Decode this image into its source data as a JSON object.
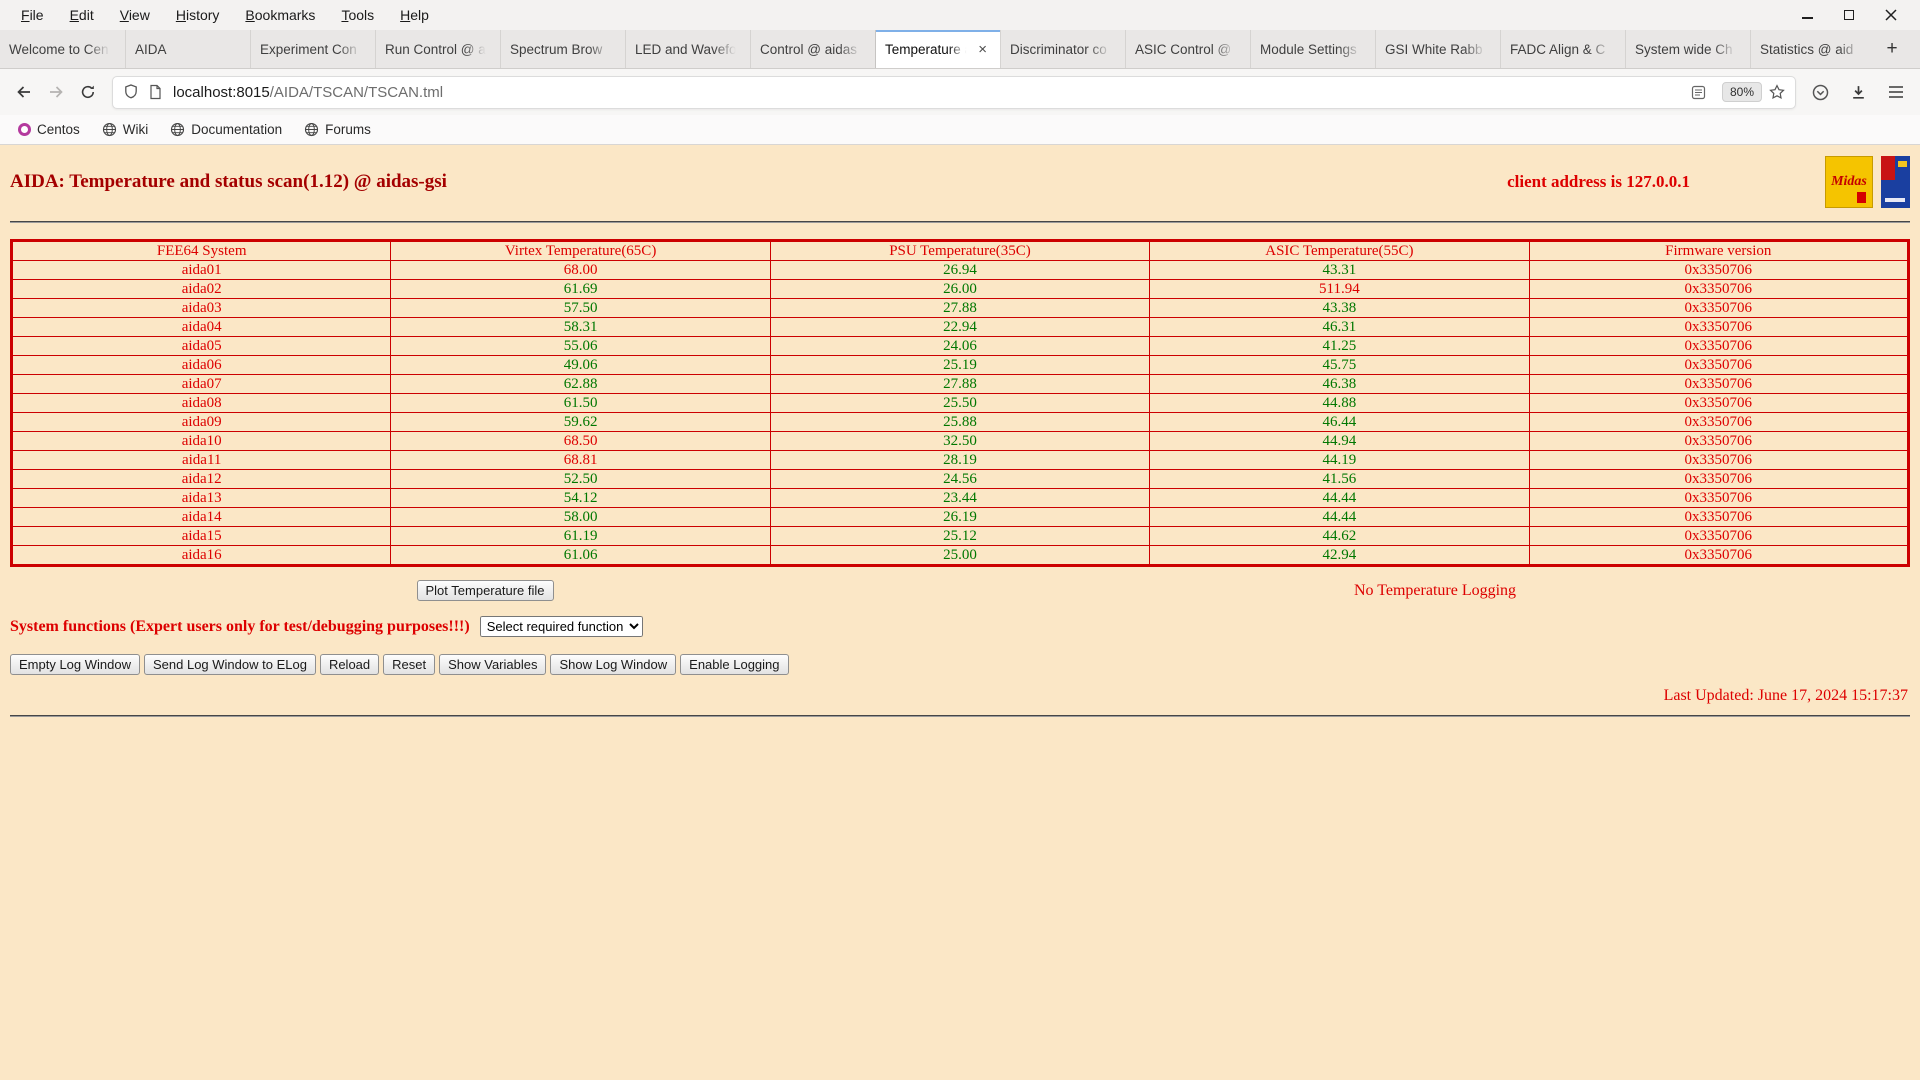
{
  "colors": {
    "page_bg": "#fbe7c6",
    "text_red": "#dd0000",
    "text_green": "#007700",
    "title_red": "#a40000",
    "table_border": "#cc0000"
  },
  "window": {
    "menu_items": [
      "File",
      "Edit",
      "View",
      "History",
      "Bookmarks",
      "Tools",
      "Help"
    ]
  },
  "tab_strip": {
    "close_glyph": "×",
    "new_tab_glyph": "+",
    "tabs": [
      {
        "label": "Welcome to Cen",
        "active": false
      },
      {
        "label": "AIDA",
        "active": false
      },
      {
        "label": "Experiment Con",
        "active": false
      },
      {
        "label": "Run Control @ a",
        "active": false
      },
      {
        "label": "Spectrum Brow",
        "active": false
      },
      {
        "label": "LED and Wavefo",
        "active": false
      },
      {
        "label": "Control @ aidas",
        "active": false
      },
      {
        "label": "Temperature an",
        "active": true
      },
      {
        "label": "Discriminator co",
        "active": false
      },
      {
        "label": "ASIC Control @",
        "active": false
      },
      {
        "label": "Module Settings",
        "active": false
      },
      {
        "label": "GSI White Rabb",
        "active": false
      },
      {
        "label": "FADC Align & C",
        "active": false
      },
      {
        "label": "System wide Ch",
        "active": false
      },
      {
        "label": "Statistics @ aid",
        "active": false
      }
    ]
  },
  "toolbar": {
    "url_host": "localhost:8015",
    "url_path": "/AIDA/TSCAN/TSCAN.tml",
    "zoom_level": "80%"
  },
  "bookmarks_bar": {
    "items": [
      "Centos",
      "Wiki",
      "Documentation",
      "Forums"
    ]
  },
  "page": {
    "title": "AIDA: Temperature and status scan(1.12) @ aidas-gsi",
    "client_address": "client address is 127.0.0.1",
    "midas_logo_text": "Midas",
    "table": {
      "headers": [
        "FEE64 System",
        "Virtex Temperature(65C)",
        "PSU Temperature(35C)",
        "ASIC Temperature(55C)",
        "Firmware version"
      ],
      "thresholds": {
        "virtex": 65,
        "psu": 35,
        "asic": 55
      },
      "rows": [
        {
          "system": "aida01",
          "virtex": "68.00",
          "psu": "26.94",
          "asic": "43.31",
          "firmware": "0x3350706"
        },
        {
          "system": "aida02",
          "virtex": "61.69",
          "psu": "26.00",
          "asic": "511.94",
          "firmware": "0x3350706"
        },
        {
          "system": "aida03",
          "virtex": "57.50",
          "psu": "27.88",
          "asic": "43.38",
          "firmware": "0x3350706"
        },
        {
          "system": "aida04",
          "virtex": "58.31",
          "psu": "22.94",
          "asic": "46.31",
          "firmware": "0x3350706"
        },
        {
          "system": "aida05",
          "virtex": "55.06",
          "psu": "24.06",
          "asic": "41.25",
          "firmware": "0x3350706"
        },
        {
          "system": "aida06",
          "virtex": "49.06",
          "psu": "25.19",
          "asic": "45.75",
          "firmware": "0x3350706"
        },
        {
          "system": "aida07",
          "virtex": "62.88",
          "psu": "27.88",
          "asic": "46.38",
          "firmware": "0x3350706"
        },
        {
          "system": "aida08",
          "virtex": "61.50",
          "psu": "25.50",
          "asic": "44.88",
          "firmware": "0x3350706"
        },
        {
          "system": "aida09",
          "virtex": "59.62",
          "psu": "25.88",
          "asic": "46.44",
          "firmware": "0x3350706"
        },
        {
          "system": "aida10",
          "virtex": "68.50",
          "psu": "32.50",
          "asic": "44.94",
          "firmware": "0x3350706"
        },
        {
          "system": "aida11",
          "virtex": "68.81",
          "psu": "28.19",
          "asic": "44.19",
          "firmware": "0x3350706"
        },
        {
          "system": "aida12",
          "virtex": "52.50",
          "psu": "24.56",
          "asic": "41.56",
          "firmware": "0x3350706"
        },
        {
          "system": "aida13",
          "virtex": "54.12",
          "psu": "23.44",
          "asic": "44.44",
          "firmware": "0x3350706"
        },
        {
          "system": "aida14",
          "virtex": "58.00",
          "psu": "26.19",
          "asic": "44.44",
          "firmware": "0x3350706"
        },
        {
          "system": "aida15",
          "virtex": "61.19",
          "psu": "25.12",
          "asic": "44.62",
          "firmware": "0x3350706"
        },
        {
          "system": "aida16",
          "virtex": "61.06",
          "psu": "25.00",
          "asic": "42.94",
          "firmware": "0x3350706"
        }
      ]
    },
    "plot_button_label": "Plot Temperature file",
    "logging_status": "No Temperature Logging",
    "system_functions_label": "System functions (Expert users only for test/debugging purposes!!!)",
    "function_select_value": "Select required function",
    "action_buttons": [
      "Empty Log Window",
      "Send Log Window to ELog",
      "Reload",
      "Reset",
      "Show Variables",
      "Show Log Window",
      "Enable Logging"
    ],
    "last_updated": "Last Updated: June 17, 2024 15:17:37"
  }
}
